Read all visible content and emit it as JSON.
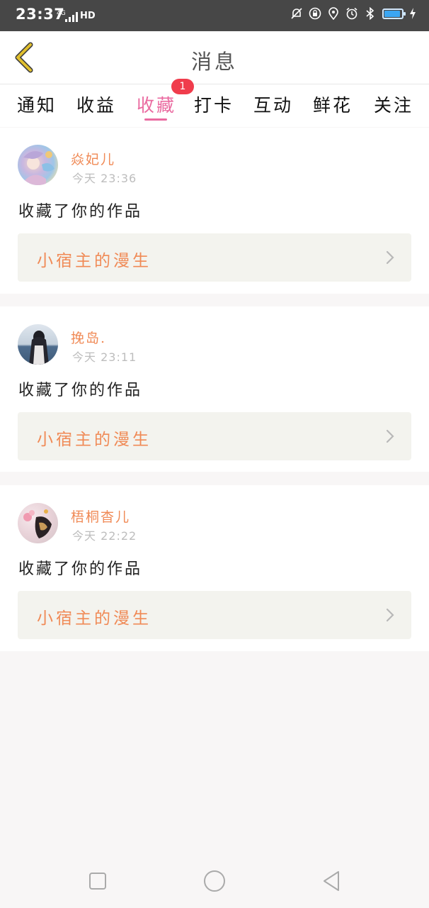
{
  "status_bar": {
    "time": "23:37",
    "network": "4G",
    "hd": "HD",
    "icons": [
      "mute-icon",
      "vpn-icon",
      "location-icon",
      "alarm-icon",
      "bluetooth-icon",
      "battery-icon"
    ],
    "battery_level": 0.92
  },
  "header": {
    "title": "消息",
    "back_icon": "chevron-left-icon"
  },
  "tabs": {
    "items": [
      "通知",
      "收益",
      "收藏",
      "打卡",
      "互动",
      "鲜花",
      "关注"
    ],
    "active": "收藏",
    "badge": "1"
  },
  "messages": [
    {
      "username": "焱妃儿",
      "time": "今天 23:36",
      "action": "收藏了你的作品",
      "work_title": "小宿主的漫生"
    },
    {
      "username": "挽岛.",
      "time": "今天 23:11",
      "action": "收藏了你的作品",
      "work_title": "小宿主的漫生"
    },
    {
      "username": "梧桐杳儿",
      "time": "今天 22:22",
      "action": "收藏了你的作品",
      "work_title": "小宿主的漫生"
    }
  ],
  "colors": {
    "accent": "#ea6aa0",
    "username": "#f08a56",
    "badge": "#f03c4c",
    "back_icon": "#e0bf2e",
    "link_bg": "#f3f3ee"
  },
  "nav_bar": {
    "icons": [
      "recent-apps-icon",
      "home-icon",
      "back-icon"
    ]
  }
}
